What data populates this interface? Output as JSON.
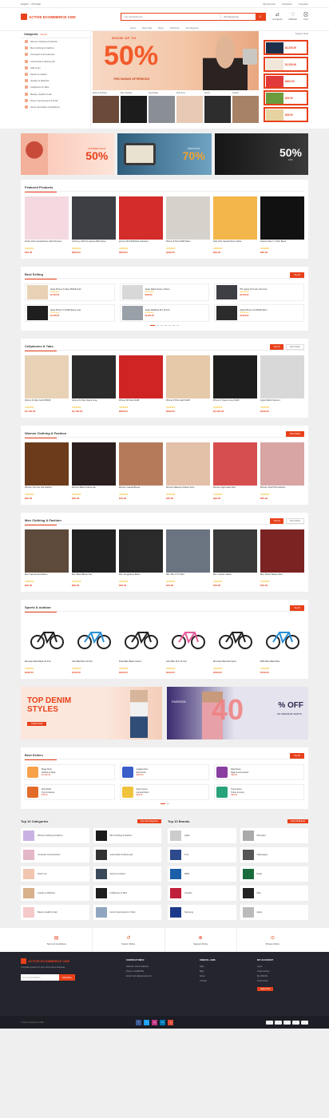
{
  "topbar": {
    "left": "English · US Dollar",
    "right": [
      "My Account",
      "Checkout",
      "Compare"
    ]
  },
  "header": {
    "logo": "ACTIVE ECOMMERCE CMS",
    "search_placeholder": "I am shopping for...",
    "search_category": "All Categories",
    "icons": [
      {
        "name": "compare",
        "label": "Compare"
      },
      {
        "name": "wishlist",
        "label": "Wishlist"
      },
      {
        "name": "cart",
        "label": "Cart"
      }
    ]
  },
  "nav": [
    "Home",
    "Flash Sale",
    "Blogs",
    "All Brands",
    "All Categories"
  ],
  "categories": {
    "title": "Categories",
    "see_all": "See All",
    "items": [
      "Women Clothing & Fashion",
      "Men Clothing & Fashion",
      "Computer & Accessories",
      "Automobile & Motorcycle",
      "Kids & toy",
      "Sports & outdoor",
      "Jewelry & Watches",
      "Cellphones & Tabs",
      "Beauty, Health & Hair",
      "Home Improvement & Tools",
      "Home decoration & Appliance"
    ]
  },
  "slider": {
    "top": "SHOW UP TO",
    "big": "50%",
    "bottom": "THIS SUNDAY AFTERNOON",
    "thumbs": [
      "Women Clothing",
      "Men Clothing",
      "Automobile",
      "Kids & toy",
      "Sports",
      "Jewelry"
    ]
  },
  "todays_deal": {
    "title": "Todays Deal",
    "prices": [
      "$2,250.00",
      "$1,250.00",
      "$629.00",
      "$29.00",
      "$39.00"
    ]
  },
  "banners": [
    {
      "big": "50%",
      "small": "SUMMER SALE"
    },
    {
      "big": "70%",
      "small": "DISCOUNT"
    },
    {
      "big": "50%",
      "small": "OFF"
    }
  ],
  "featured": {
    "title": "Featured Products",
    "items": [
      {
        "name": "Pretty Girls Casual Dress Little Princess",
        "price": "$19.00",
        "old": ""
      },
      {
        "name": "HP Envy x360 13 Laptop AMD Ryzen",
        "price": "$849.00",
        "old": ""
      },
      {
        "name": "iphone XR 64GB Red Unlocked",
        "price": "$629.00",
        "old": ""
      },
      {
        "name": "iPhone 8 Plus 64GB Silver",
        "price": "$499.00",
        "old": ""
      },
      {
        "name": "Kids Girls Casual Dress Yellow",
        "price": "$29.00",
        "old": ""
      },
      {
        "name": "Fashion Men's T-Shirt Black",
        "price": "$39.00",
        "old": ""
      }
    ]
  },
  "best_selling": {
    "title": "Best Selling",
    "tab": "Top 20",
    "items": [
      {
        "name": "Apple iPhone Xs Max 256GB Gold",
        "price": "$1,150.00"
      },
      {
        "name": "Apple Watch Series 4 Silver",
        "price": "$429.00"
      },
      {
        "name": "HP Laptop 15.6 Inch Intel Core",
        "price": "$1,250.00"
      },
      {
        "name": "Apple iPhone X 64GB Space Gray",
        "price": "$1,150.00"
      },
      {
        "name": "Apple MacBook Pro 13 Inch",
        "price": "$2,250.00"
      },
      {
        "name": "Apple iPhone XS 256GB Silver",
        "price": "$1,020.00"
      }
    ]
  },
  "cellphones": {
    "title": "Cellphones & Tabs",
    "tabs": [
      "Top 20",
      "Best Seller"
    ],
    "items": [
      {
        "name": "Iphone Xs Max Gold 256GB",
        "price": "$1,150.00"
      },
      {
        "name": "Iphone Xs Max Space Gray",
        "price": "$1,150.00"
      },
      {
        "name": "iPhone XR Red 64GB",
        "price": "$629.00"
      },
      {
        "name": "iPhone 8 Plus Gold 64GB",
        "price": "$499.00"
      },
      {
        "name": "iPhone X Space Gray 64GB",
        "price": "$1,020.00"
      },
      {
        "name": "Apple Watch Series 4",
        "price": "$429.00"
      }
    ]
  },
  "women": {
    "title": "Women Clothing & Fashion",
    "tab": "Best Seller",
    "items": [
      {
        "name": "Women Summer Hat Fashion",
        "price": "$29.00"
      },
      {
        "name": "Women Black Fedora Hat",
        "price": "$39.00"
      },
      {
        "name": "Women Casual Blouse",
        "price": "$19.00"
      },
      {
        "name": "Women Makeup Fashion Style",
        "price": "$45.00"
      },
      {
        "name": "Women High Heels Red",
        "price": "$29.00"
      },
      {
        "name": "Women Scarf Pink Fashion",
        "price": "$25.00"
      }
    ]
  },
  "men": {
    "title": "Men Clothing & Fashion",
    "tabs": [
      "Top 20",
      "Best Seller"
    ],
    "items": [
      {
        "name": "Men Casual Hat Fashion",
        "price": "$39.00"
      },
      {
        "name": "Men Black Blazer Suit",
        "price": "$89.00"
      },
      {
        "name": "Men Sunglasses Black",
        "price": "$29.00"
      },
      {
        "name": "Men Slim Fit T-Shirt",
        "price": "$19.00"
      },
      {
        "name": "Men Leather Jacket",
        "price": "$79.00"
      },
      {
        "name": "Men Winter Beanie Red",
        "price": "$15.00"
      }
    ]
  },
  "sports": {
    "title": "Sports & outdoor",
    "tab": "Top 20",
    "items": [
      {
        "name": "Mountain Bike Black 26 Inch",
        "price": "$189.00"
      },
      {
        "name": "Kids Bike Blue 20 Inch",
        "price": "$149.00"
      },
      {
        "name": "Road Bike Black Carbon",
        "price": "$229.00"
      },
      {
        "name": "Girls Bike Pink 16 Inch",
        "price": "$119.00"
      },
      {
        "name": "Mountain Bike Red Sport",
        "price": "$199.00"
      },
      {
        "name": "BMX Bike Black Blue",
        "price": "$159.00"
      }
    ]
  },
  "promo": {
    "left_big": "TOP DENIM",
    "left_big2": "STYLES",
    "left_btn": "SHOP NOW",
    "right_small": "FASHION",
    "right_big": "40",
    "right_off": "% OFF",
    "right_sub": "ON PREMIUM SHIRTS"
  },
  "best_sellers": {
    "title": "Best Sellers",
    "tab": "Top 20",
    "items": [
      {
        "name": "Mega Store",
        "sub": "Fashion & Style",
        "price": "$1,150.00"
      },
      {
        "name": "Gadget Zone",
        "sub": "Electronics",
        "price": "$629.00"
      },
      {
        "name": "Bag House",
        "sub": "Bags & Accessories",
        "price": "$39.00"
      },
      {
        "name": "Kids World",
        "sub": "Toys & Games",
        "price": "$19.00"
      },
      {
        "name": "Shop Corner",
        "sub": "General Store",
        "price": "$29.00"
      },
      {
        "name": "Home Deco",
        "sub": "Home & Living",
        "price": "$49.00"
      }
    ]
  },
  "top_categories": {
    "title": "Top 10 Categories",
    "btn": "View All Categories",
    "items": [
      "Women Clothing & Fashion",
      "Men Clothing & Fashion",
      "Computer & Accessories",
      "Automobile & Motorcycle",
      "Kids & toy",
      "Sports & outdoor",
      "Jewelry & Watches",
      "Cellphones & Tabs",
      "Beauty, Health & Hair",
      "Home Improvement & Tools"
    ]
  },
  "top_brands": {
    "title": "Top 10 Brands",
    "btn": "View All Brands",
    "items": [
      "Apple",
      "Mercedes",
      "Ford",
      "Volkswagen",
      "BMW",
      "Rolex",
      "Yamaha",
      "Nike",
      "Samsung",
      "Apple"
    ]
  },
  "features": [
    "Terms & Conditions",
    "Return Policy",
    "Support Policy",
    "Privacy Policy"
  ],
  "footer": {
    "logo": "ACTIVE ECOMMERCE CMS",
    "about": "Complete system for your eCommerce business",
    "sub_placeholder": "Your Email Address",
    "sub_btn": "Subscribe",
    "col1_title": "CONTACT INFO",
    "col1": [
      "Address: Demo Address",
      "Phone: 123456789",
      "Email: demo@example.com"
    ],
    "col2_title": "USEFUL LINK",
    "col2": [
      "Help",
      "Blog",
      "About",
      "Contact"
    ],
    "col3_title": "MY ACCOUNT",
    "col3": [
      "Login",
      "Order History",
      "My Wishlist",
      "Track Order"
    ],
    "seller_btn": "Apply Now"
  },
  "copyright": "© Active eCommerce CMS",
  "colors": {
    "accent": "#e8411b"
  }
}
